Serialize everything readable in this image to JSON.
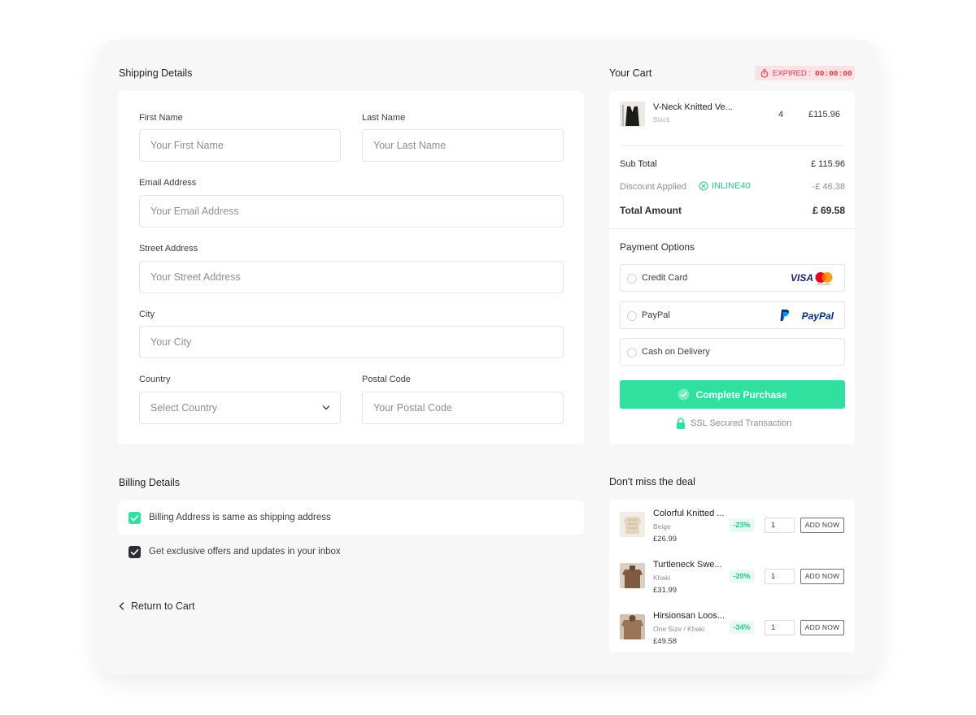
{
  "shipping": {
    "title": "Shipping Details",
    "first_name": {
      "label": "First Name",
      "placeholder": "Your First Name"
    },
    "last_name": {
      "label": "Last Name",
      "placeholder": "Your Last Name"
    },
    "email": {
      "label": "Email Address",
      "placeholder": "Your Email Address"
    },
    "street": {
      "label": "Street Address",
      "placeholder": "Your Street Address"
    },
    "city": {
      "label": "City",
      "placeholder": "Your City"
    },
    "country": {
      "label": "Country",
      "value": "Select Country"
    },
    "postal": {
      "label": "Postal Code",
      "placeholder": "Your Postal Code"
    }
  },
  "billing": {
    "title": "Billing Details",
    "same_address": {
      "label": "Billing Address is same as shipping address",
      "checked": true
    },
    "offers": {
      "label": "Get exclusive offers and updates in your inbox",
      "checked": true
    },
    "return_label": "Return to Cart"
  },
  "cart": {
    "title": "Your Cart",
    "expired_label": "EXPIRED :",
    "expired_timer": "00:00:00",
    "item": {
      "name": "V-Neck Knitted Ve...",
      "variant": "Black",
      "qty": "4",
      "price": "£115.96"
    },
    "subtotal_label": "Sub Total",
    "subtotal_value": "£ 115.96",
    "discount_label": "Discount Applied",
    "discount_code": "INLINE40",
    "discount_value": "-£ 46.38",
    "total_label": "Total Amount",
    "total_value": "£ 69.58",
    "payment_title": "Payment Options",
    "payment_options": [
      {
        "label": "Credit Card",
        "logo": "VISA"
      },
      {
        "label": "PayPal",
        "logo": "PayPal"
      },
      {
        "label": "Cash on Delivery"
      }
    ],
    "purchase_label": "Complete Purchase",
    "ssl_label": "SSL Secured Transaction"
  },
  "deals": {
    "title": "Don't miss the deal",
    "items": [
      {
        "name": "Colorful Knitted ...",
        "variant": "Beige",
        "price": "£26.99",
        "discount": "-23%",
        "qty": "1",
        "button": "ADD NOW"
      },
      {
        "name": "Turtleneck Swe...",
        "variant": "Khaki",
        "price": "£31.99",
        "discount": "-20%",
        "qty": "1",
        "button": "ADD NOW"
      },
      {
        "name": "Hirsionsan Loos...",
        "variant": "One Size / Khaki",
        "price": "£49.58",
        "discount": "-34%",
        "qty": "1",
        "button": "ADD NOW"
      }
    ]
  },
  "colors": {
    "accent": "#2fe09f",
    "expired_bg": "#fde2e5",
    "expired_text": "#e0374f"
  }
}
